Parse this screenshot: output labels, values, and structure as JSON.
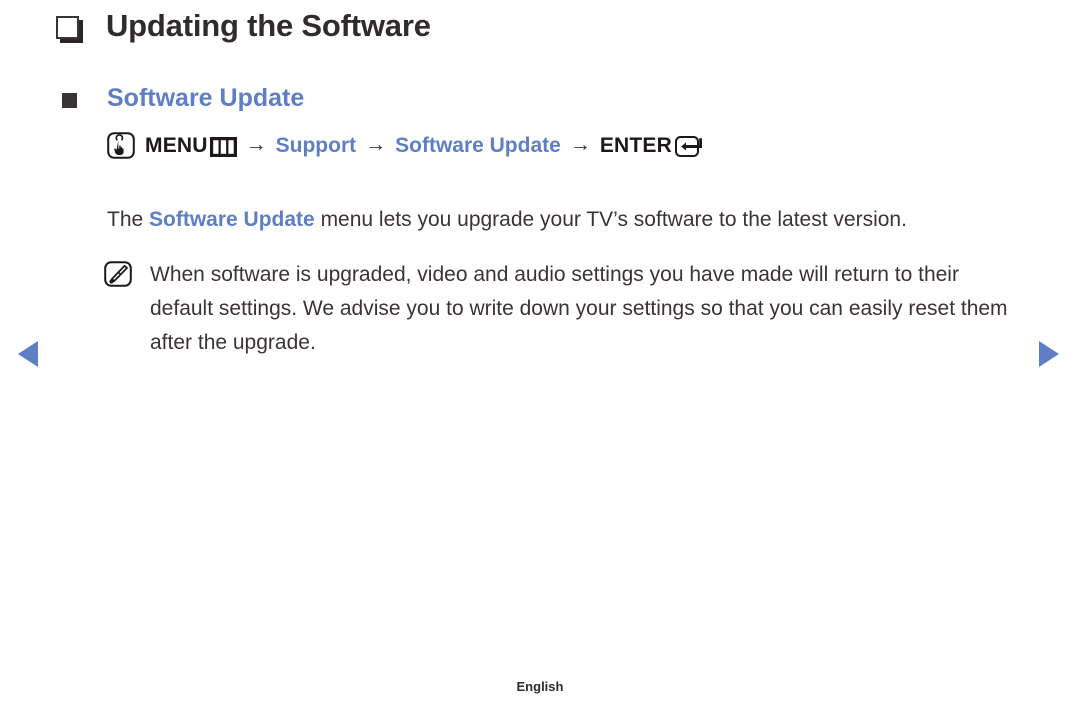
{
  "page": {
    "title": "Updating the Software",
    "title_bullet_icon": "hollow-square-bullet-icon",
    "language_footer": "English"
  },
  "section": {
    "heading": "Software Update",
    "heading_bullet_icon": "filled-square-bullet-icon",
    "accent_color": "#5e7fc3",
    "text_color": "#3a3438"
  },
  "menu_path": {
    "oo_icon": "hand-press-button-icon",
    "menu_label": "MENU",
    "menu_glyph_icon": "menu-bars-icon",
    "arrow_1": "→",
    "step_support": "Support",
    "arrow_2": "→",
    "step_software_update": "Software Update",
    "arrow_3": "→",
    "enter_label": "ENTER",
    "enter_glyph_icon": "enter-return-key-icon"
  },
  "body": {
    "lead_text": "The ",
    "emphasis_text": "Software Update",
    "trail_text": " menu lets you upgrade your TV’s software to the latest version."
  },
  "note": {
    "icon": "note-pencil-icon",
    "text": "When software is upgraded, video and audio settings you have made will return to their default settings. We advise you to write down your settings so that you can easily reset them after the upgrade."
  },
  "navigation": {
    "prev_icon": "previous-page-triangle-icon",
    "next_icon": "next-page-triangle-icon",
    "arrow_color": "#5e7fc3"
  }
}
